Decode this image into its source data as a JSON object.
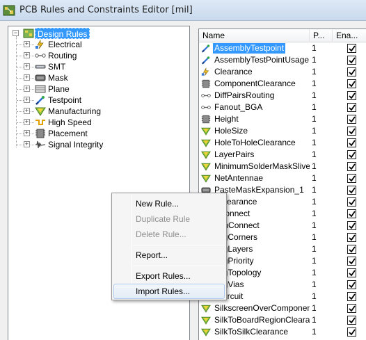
{
  "window": {
    "title": "PCB Rules and Constraints Editor [mil]"
  },
  "tree": {
    "root_label": "Design Rules",
    "items": [
      {
        "label": "Electrical",
        "icon": "electrical-icon"
      },
      {
        "label": "Routing",
        "icon": "routing-icon"
      },
      {
        "label": "SMT",
        "icon": "smt-icon"
      },
      {
        "label": "Mask",
        "icon": "mask-icon"
      },
      {
        "label": "Plane",
        "icon": "plane-icon"
      },
      {
        "label": "Testpoint",
        "icon": "testpoint-icon"
      },
      {
        "label": "Manufacturing",
        "icon": "manufacturing-icon"
      },
      {
        "label": "High Speed",
        "icon": "high-speed-icon"
      },
      {
        "label": "Placement",
        "icon": "placement-icon"
      },
      {
        "label": "Signal Integrity",
        "icon": "signal-integrity-icon"
      }
    ]
  },
  "rules_list": {
    "columns": {
      "name": "Name",
      "priority": "P...",
      "enabled": "Ena..."
    },
    "rows": [
      {
        "name": "AssemblyTestpoint",
        "priority": "1",
        "enabled": true,
        "icon": "testpoint-icon",
        "selected": true
      },
      {
        "name": "AssemblyTestPointUsage",
        "priority": "1",
        "enabled": true,
        "icon": "testpoint-icon"
      },
      {
        "name": "Clearance",
        "priority": "1",
        "enabled": true,
        "icon": "electrical-icon"
      },
      {
        "name": "ComponentClearance",
        "priority": "1",
        "enabled": true,
        "icon": "placement-icon"
      },
      {
        "name": "DiffPairsRouting",
        "priority": "1",
        "enabled": true,
        "icon": "routing-icon"
      },
      {
        "name": "Fanout_BGA",
        "priority": "1",
        "enabled": true,
        "icon": "routing-icon"
      },
      {
        "name": "Height",
        "priority": "1",
        "enabled": true,
        "icon": "placement-icon"
      },
      {
        "name": "HoleSize",
        "priority": "1",
        "enabled": true,
        "icon": "manufacturing-icon"
      },
      {
        "name": "HoleToHoleClearance",
        "priority": "1",
        "enabled": true,
        "icon": "manufacturing-icon"
      },
      {
        "name": "LayerPairs",
        "priority": "1",
        "enabled": true,
        "icon": "manufacturing-icon"
      },
      {
        "name": "MinimumSolderMaskSliver",
        "priority": "1",
        "enabled": true,
        "icon": "manufacturing-icon"
      },
      {
        "name": "NetAntennae",
        "priority": "1",
        "enabled": true,
        "icon": "manufacturing-icon"
      },
      {
        "name": "PasteMaskExpansion_1",
        "priority": "1",
        "enabled": true,
        "icon": "mask-icon"
      },
      {
        "name": "eClearance",
        "priority": "1",
        "enabled": true,
        "icon": "plane-icon"
      },
      {
        "name": "eConnect",
        "priority": "1",
        "enabled": true,
        "icon": "plane-icon"
      },
      {
        "name": "gonConnect",
        "priority": "1",
        "enabled": true,
        "icon": "plane-icon"
      },
      {
        "name": "tingCorners",
        "priority": "1",
        "enabled": true,
        "icon": "routing-icon"
      },
      {
        "name": "tingLayers",
        "priority": "1",
        "enabled": true,
        "icon": "routing-icon"
      },
      {
        "name": "tingPriority",
        "priority": "1",
        "enabled": true,
        "icon": "routing-icon"
      },
      {
        "name": "tingTopology",
        "priority": "1",
        "enabled": true,
        "icon": "routing-icon"
      },
      {
        "name": "tingVias",
        "priority": "1",
        "enabled": true,
        "icon": "routing-icon"
      },
      {
        "name": "rtCircuit",
        "priority": "1",
        "enabled": true,
        "icon": "electrical-icon"
      },
      {
        "name": "SilkscreenOverComponentI",
        "priority": "1",
        "enabled": true,
        "icon": "manufacturing-icon"
      },
      {
        "name": "SilkToBoardRegionClearan",
        "priority": "1",
        "enabled": true,
        "icon": "manufacturing-icon"
      },
      {
        "name": "SilkToSilkClearance",
        "priority": "1",
        "enabled": true,
        "icon": "manufacturing-icon"
      }
    ]
  },
  "context_menu": {
    "items": [
      {
        "label": "New Rule...",
        "disabled": false
      },
      {
        "label": "Duplicate Rule",
        "disabled": true
      },
      {
        "label": "Delete Rule...",
        "disabled": true
      },
      {
        "label": "Report...",
        "disabled": false
      },
      {
        "label": "Export Rules...",
        "disabled": false
      },
      {
        "label": "Import Rules...",
        "disabled": false,
        "hovered": true
      }
    ]
  },
  "colors": {
    "selection": "#3399ff",
    "titlebar": "#c9daee",
    "menu_hover_border": "#aecbee"
  }
}
